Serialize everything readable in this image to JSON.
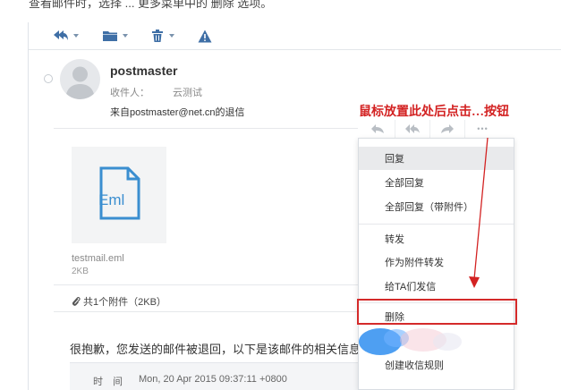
{
  "caption": "查看邮件时，选择 ... 更多菜单中的 删除 选项。",
  "toolbar": {
    "icons": [
      "reply-all-icon",
      "folder-icon",
      "trash-icon",
      "warning-icon"
    ]
  },
  "email": {
    "sender": "postmaster",
    "recipient_label": "收件人：",
    "recipient_value": "云测试",
    "subject": "来自postmaster@net.cn的退信"
  },
  "annotation": "鼠标放置此处后点击…按钮",
  "more_button": "•••",
  "attachment": {
    "name": "testmail.eml",
    "size": "2KB",
    "summary": "共1个附件（2KB）",
    "icon_label": "Eml"
  },
  "menu": {
    "items": [
      {
        "label": "回复"
      },
      {
        "label": "全部回复"
      },
      {
        "label": "全部回复（带附件）"
      },
      {
        "label": "转发"
      },
      {
        "label": "作为附件转发"
      },
      {
        "label": "给TA们发信"
      },
      {
        "label": "删除"
      },
      {
        "label": "创建收信规则"
      }
    ]
  },
  "body": {
    "text": "很抱歉，您发送的邮件被退回，以下是该邮件的相关信息：",
    "info_key": "时　间",
    "info_value": "Mon, 20 Apr 2015 09:37:11 +0800"
  },
  "colors": {
    "accent": "#3f6fa6",
    "annotation": "#d32222",
    "highlight": "#d42a2a"
  }
}
